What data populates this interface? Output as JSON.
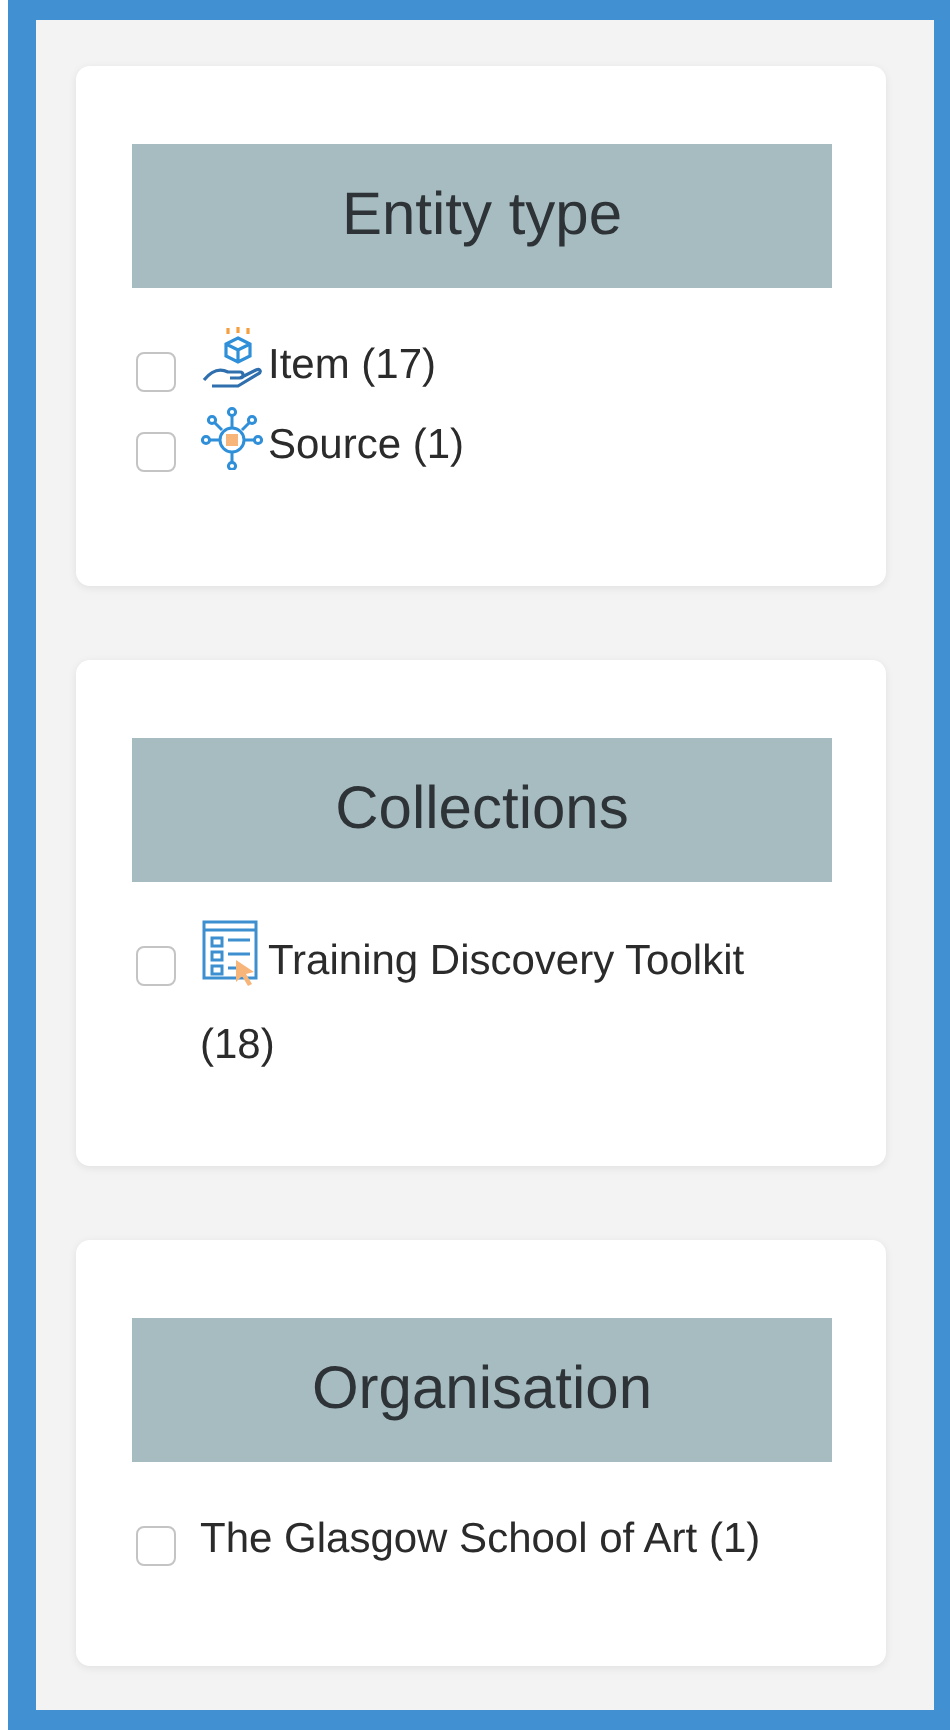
{
  "facets": [
    {
      "title": "Entity type",
      "options": [
        {
          "label": "Item (17)",
          "kind": "item",
          "checked": false
        },
        {
          "label": "Source (1)",
          "kind": "source",
          "checked": false
        }
      ]
    },
    {
      "title": "Collections",
      "options": [
        {
          "label": "Training Discovery Toolkit (18)",
          "kind": "collection",
          "checked": false
        }
      ]
    },
    {
      "title": "Organisation",
      "options": [
        {
          "label": "The Glasgow School of Art (1)",
          "kind": "plain",
          "checked": false
        }
      ]
    }
  ]
}
